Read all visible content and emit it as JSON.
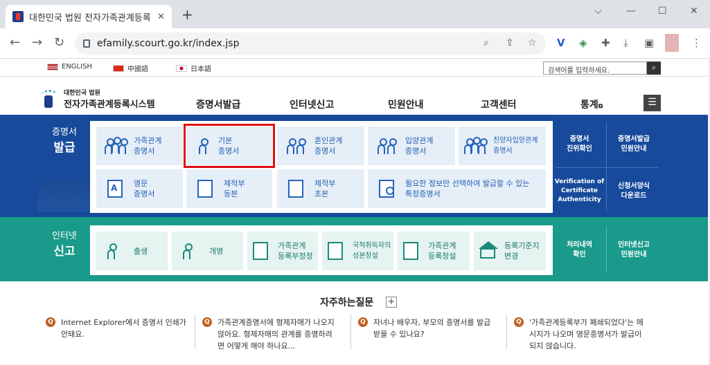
{
  "browser": {
    "tab_title": "대한민국 법원 전자가족관계등록",
    "url": "efamily.scourt.go.kr/index.jsp",
    "new_tab": "+",
    "min": "⌵",
    "close_tab": "✕"
  },
  "langs": {
    "english": "ENGLISH",
    "chinese": "中國語",
    "japanese": "日本語"
  },
  "search": {
    "placeholder": "검색어를 입력하세요."
  },
  "logo": {
    "sub": "대한민국 법원",
    "main": "전자가족관계등록시스템"
  },
  "gnb": {
    "m1": "증명서발급",
    "m2": "인터넷신고",
    "m3": "민원안내",
    "m4": "고객센터",
    "m5": "통계"
  },
  "issue": {
    "label1": "증명서",
    "label2": "발급",
    "c1a": "가족관계",
    "c1b": "증명서",
    "c2a": "기본",
    "c2b": "증명서",
    "c3a": "혼인관계",
    "c3b": "증명서",
    "c4a": "입양관계",
    "c4b": "증명서",
    "c5a": "친양자입양관계",
    "c5b": "증명서",
    "c6a": "영문",
    "c6b": "증명서",
    "c7a": "제적부",
    "c7b": "등본",
    "c8a": "제적부",
    "c8b": "초본",
    "c9a": "필요한 정보만 선택하여 발급할 수 있는",
    "c9b": "특정증명서",
    "s1a": "증명서",
    "s1b": "진위확인",
    "s2a": "증명서발급",
    "s2b": "민원안내",
    "s3a": "Verification of",
    "s3b": "Certificate",
    "s3c": "Authenticity",
    "s4a": "신청서양식",
    "s4b": "다운로드"
  },
  "report": {
    "label1": "인터넷",
    "label2": "신고",
    "c1": "출생",
    "c2": "개명",
    "c3a": "가족관계",
    "c3b": "등록부정정",
    "c4a": "국적취득자의",
    "c4b": "성본창설",
    "c5a": "가족관계",
    "c5b": "등록창설",
    "c6a": "등록기준지",
    "c6b": "변경",
    "s1a": "처리내역",
    "s1b": "확인",
    "s2a": "인터넷신고",
    "s2b": "민원안내"
  },
  "faq": {
    "title": "자주하는질문",
    "plus": "+",
    "q": "Q",
    "f1a": "Internet Explorer에서 증명서 인쇄가",
    "f1b": "안돼요.",
    "f2a": "가족관계증명서에 형제자매가 나오지",
    "f2b": "않아요. 형제자매의 관계를 증명하려",
    "f2c": "면 어떻게 해야 하나요...",
    "f3a": "자녀나 배우자, 부모의 증명서를 발급",
    "f3b": "받을 수 있나요?",
    "f4a": "'가족관계등록부가 폐쇄되었다'는 메",
    "f4b": "시지가 나오며 영문증명서가 발급이",
    "f4c": "되지 않습니다."
  }
}
